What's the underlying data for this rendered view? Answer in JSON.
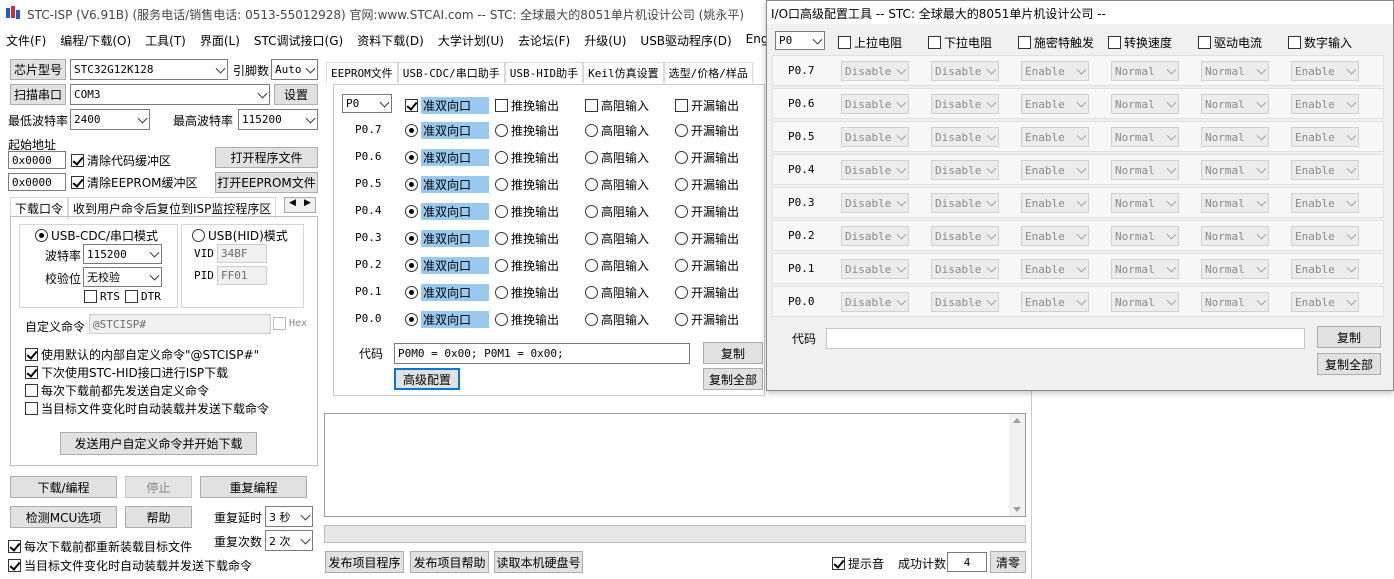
{
  "main": {
    "title": "STC-ISP (V6.91B) (服务电话/销售电话: 0513-55012928) 官网:www.STCAI.com  -- STC: 全球最大的8051单片机设计公司 (姚永平)",
    "menu": [
      "文件(F)",
      "编程/下载(O)",
      "工具(T)",
      "界面(L)",
      "STC调试接口(G)",
      "资料下载(D)",
      "大学计划(U)",
      "去论坛(F)",
      "升级(U)",
      "USB驱动程序(D)",
      "English"
    ]
  },
  "left": {
    "chip_btn": "芯片型号",
    "chip_value": "STC32G12K128",
    "pins_label": "引脚数",
    "pins_value": "Auto",
    "scan_btn": "扫描串口",
    "port_value": "COM3",
    "settings_btn": "设置",
    "min_baud_label": "最低波特率",
    "min_baud_value": "2400",
    "max_baud_label": "最高波特率",
    "max_baud_value": "115200",
    "start_addr_label": "起始地址",
    "addr1": "0x0000",
    "clear_code": "清除代码缓冲区",
    "open_prog": "打开程序文件",
    "addr2": "0x0000",
    "clear_eeprom": "清除EEPROM缓冲区",
    "open_eeprom": "打开EEPROM文件",
    "tab1": "下载口令",
    "tab2": "收到用户命令后复位到ISP监控程序区",
    "usb_cdc_mode": "USB-CDC/串口模式",
    "usb_hid_mode": "USB(HID)模式",
    "baud_label": "波特率",
    "baud_value": "115200",
    "parity_label": "校验位",
    "parity_value": "无校验",
    "rts": "RTS",
    "dtr": "DTR",
    "vid_label": "VID",
    "vid_value": "34BF",
    "pid_label": "PID",
    "pid_value": "FF01",
    "custom_cmd_label": "自定义命令",
    "custom_cmd_value": "@STCISP#",
    "hex_label": "Hex",
    "opt1": "使用默认的内部自定义命令\"@STCISP#\"",
    "opt2": "下次使用STC-HID接口进行ISP下载",
    "opt3": "每次下载前都先发送自定义命令",
    "opt4": "当目标文件变化时自动装载并发送下载命令",
    "send_btn": "发送用户自定义命令并开始下载",
    "download_btn": "下载/编程",
    "stop_btn": "停止",
    "reprogram_btn": "重复编程",
    "detect_btn": "检测MCU选项",
    "help_btn": "帮助",
    "delay_label": "重复延时",
    "delay_value": "3 秒",
    "count_label": "重复次数",
    "count_value": "2 次",
    "reload_opt": "每次下载前都重新装载目标文件",
    "auto_opt": "当目标文件变化时自动装载并发送下载命令"
  },
  "middle": {
    "tabs": [
      "EEPROM文件",
      "USB-CDC/串口助手",
      "USB-HID助手",
      "Keil仿真设置",
      "选型/价格/样品"
    ],
    "port_select": "P0",
    "modes": [
      "准双向口",
      "推挽输出",
      "高阻输入",
      "开漏输出"
    ],
    "pins": [
      "P0.7",
      "P0.6",
      "P0.5",
      "P0.4",
      "P0.3",
      "P0.2",
      "P0.1",
      "P0.0"
    ],
    "code_label": "代码",
    "code_value": "P0M0 = 0x00;  P0M1 = 0x00;",
    "copy_btn": "复制",
    "adv_btn": "高级配置",
    "copy_all_btn": "复制全部",
    "pub_prog_btn": "发布项目程序",
    "pub_help_btn": "发布项目帮助",
    "read_disk_btn": "读取本机硬盘号",
    "sound_label": "提示音",
    "success_label": "成功计数",
    "success_value": "4",
    "clear_btn": "清零"
  },
  "advanced": {
    "title": "I/O口高级配置工具 -- STC: 全球最大的8051单片机设计公司 --",
    "port_select": "P0",
    "headers": [
      "上拉电阻",
      "下拉电阻",
      "施密特触发",
      "转换速度",
      "驱动电流",
      "数字输入"
    ],
    "pins": [
      "P0.7",
      "P0.6",
      "P0.5",
      "P0.4",
      "P0.3",
      "P0.2",
      "P0.1",
      "P0.0"
    ],
    "row_values": [
      "Disable",
      "Disable",
      "Enable",
      "Normal",
      "Normal",
      "Enable"
    ],
    "code_label": "代码",
    "copy_btn": "复制",
    "copy_all_btn": "复制全部"
  }
}
